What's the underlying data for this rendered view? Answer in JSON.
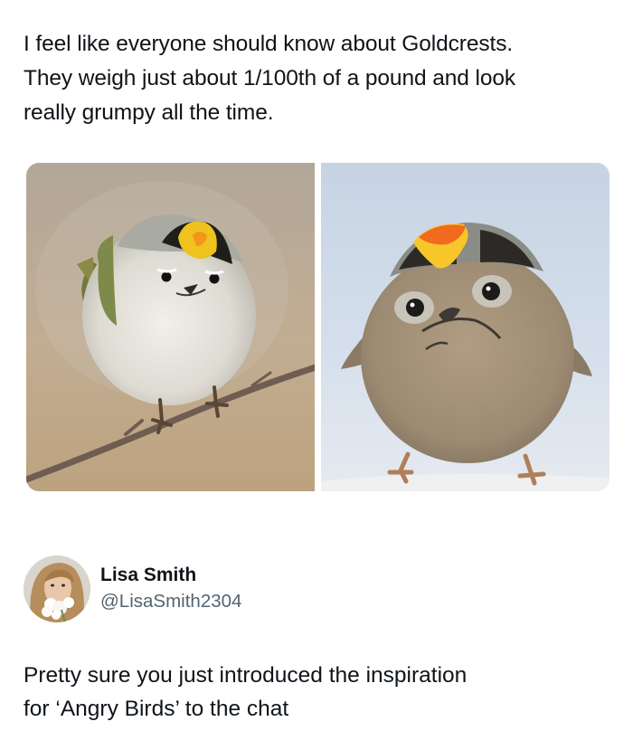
{
  "post": {
    "text": "I feel like everyone should know about Goldcrests.\nThey weigh just about 1/100th of a pound and look\nreally grumpy all the time."
  },
  "media": {
    "images": [
      {
        "icon": "goldcrest-on-branch-photo"
      },
      {
        "icon": "grumpy-goldcrest-photo"
      }
    ]
  },
  "reply": {
    "author": {
      "name": "Lisa Smith",
      "handle": "@LisaSmith2304",
      "avatar_icon": "profile-avatar"
    },
    "text": "Pretty sure you just introduced the inspiration\nfor ‘Angry Birds’ to the chat"
  },
  "colors": {
    "text": "#0f1419",
    "secondary_text": "#536471",
    "background": "#ffffff"
  }
}
